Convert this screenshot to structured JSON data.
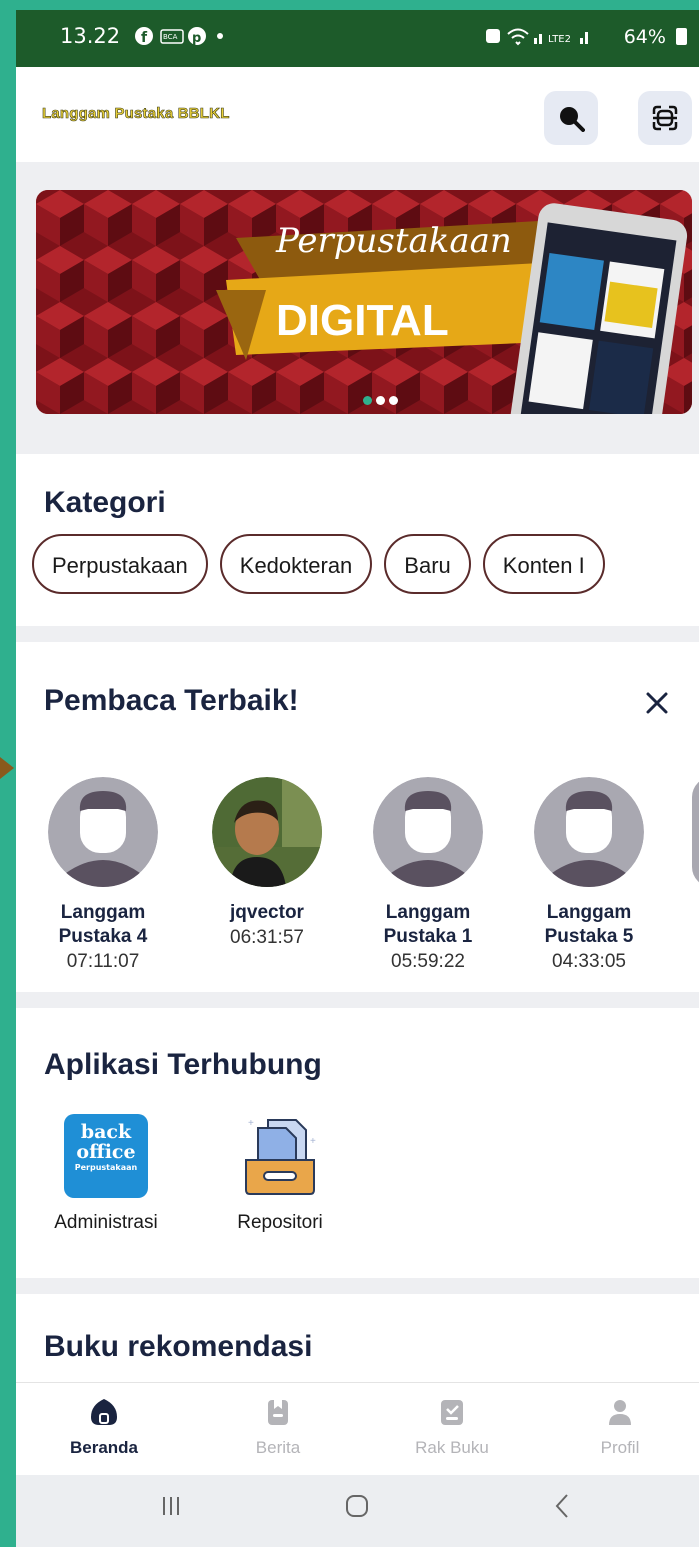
{
  "status_bar": {
    "time": "13.22",
    "left_icons": "● ⊙ •",
    "signal_text": "64%",
    "icons": [
      "facebook-icon",
      "bca-icon",
      "pinterest-icon",
      "wifi-icon",
      "signal-icon",
      "battery-icon"
    ]
  },
  "app_bar": {
    "title": "Langgam Pustaka BBLKL",
    "actions": [
      "search-icon",
      "scan-icon"
    ]
  },
  "banner": {
    "script_text": "Perpustakaan",
    "main_text": "DIGITAL",
    "slides": 3,
    "active_slide": 1
  },
  "categories": {
    "title": "Kategori",
    "chips": [
      "Perpustakaan",
      "Kedokteran",
      "Baru",
      "Konten I"
    ]
  },
  "readers": {
    "title": "Pembaca Terbaik!",
    "close_icon": "close-icon",
    "items": [
      {
        "name1": "Langgam",
        "name2": "Pustaka 4",
        "time": "07:11:07"
      },
      {
        "name1": "jqvector",
        "name2": "",
        "time": "06:31:57"
      },
      {
        "name1": "Langgam",
        "name2": "Pustaka 1",
        "time": "05:59:22"
      },
      {
        "name1": "Langgam",
        "name2": "Pustaka 5",
        "time": "04:33:05"
      }
    ]
  },
  "apps": {
    "title": "Aplikasi Terhubung",
    "items": [
      {
        "label": "Administrasi",
        "logo_line1": "back",
        "logo_line2": "office",
        "logo_line3": "Perpustakaan"
      },
      {
        "label": "Repositori"
      }
    ]
  },
  "recommended": {
    "title": "Buku rekomendasi"
  },
  "bottom_nav": {
    "items": [
      {
        "label": "Beranda",
        "icon": "home-icon",
        "active": true
      },
      {
        "label": "Berita",
        "icon": "news-icon",
        "active": false
      },
      {
        "label": "Rak Buku",
        "icon": "bookshelf-icon",
        "active": false
      },
      {
        "label": "Profil",
        "icon": "profile-icon",
        "active": false
      }
    ]
  },
  "colors": {
    "frame": "#2fb08e",
    "status_bar": "#1d5b2a",
    "heading": "#1a2440",
    "chip_border": "#5a2b2b"
  }
}
